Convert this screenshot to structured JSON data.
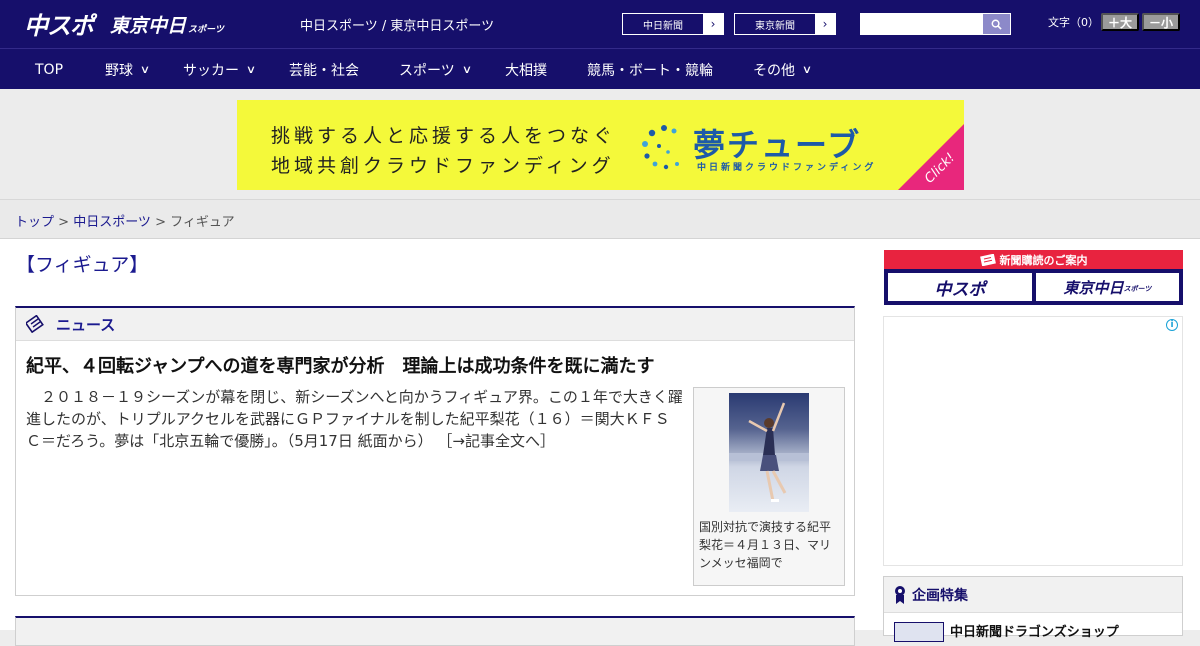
{
  "header": {
    "logo_main": "中スポ",
    "logo_sub": "東京中日",
    "logo_sub_small": "スポーツ",
    "site_title": "中日スポーツ / 東京中日スポーツ",
    "buttons": [
      {
        "label": "中日新聞"
      },
      {
        "label": "東京新聞"
      }
    ],
    "search": {
      "value": "",
      "placeholder": ""
    },
    "font_label": "文字（0）",
    "font_increase": "＋大",
    "font_decrease": "－小"
  },
  "nav": [
    {
      "label": "TOP",
      "dropdown": false
    },
    {
      "label": "野球",
      "dropdown": true
    },
    {
      "label": "サッカー",
      "dropdown": true
    },
    {
      "label": "芸能・社会",
      "dropdown": false
    },
    {
      "label": "スポーツ",
      "dropdown": true
    },
    {
      "label": "大相撲",
      "dropdown": false
    },
    {
      "label": "競馬・ボート・競輪",
      "dropdown": false
    },
    {
      "label": "その他",
      "dropdown": true
    }
  ],
  "banner": {
    "line1": "挑戦する人と応援する人をつなぐ",
    "line2": "地域共創クラウドファンディング",
    "brand": "夢チューブ",
    "brand_sub": "中日新聞クラウドファンディング",
    "click": "Click!"
  },
  "breadcrumb": {
    "home": "トップ",
    "sep1": " > ",
    "section": "中日スポーツ",
    "sep2": " > ",
    "current": "フィギュア"
  },
  "main": {
    "section_heading": "【フィギュア】",
    "news_label": "ニュース",
    "article": {
      "title": "紀平、４回転ジャンプへの道を専門家が分析　理論上は成功条件を既に満たす",
      "body": "　２０１８－１９シーズンが幕を閉じ、新シーズンへと向かうフィギュア界。この１年で大きく躍進したのが、トリプルアクセルを武器にＧＰファイナルを制した紀平梨花（１６）＝関大ＫＦＳＣ＝だろう。夢は「北京五輪で優勝」。（5月17日 紙面から）",
      "more": "［→記事全文へ］",
      "photo_caption": "国別対抗で演技する紀平梨花＝４月１３日、マリンメッセ福岡で"
    }
  },
  "sidebar": {
    "subscribe_head": "新聞購読のご案内",
    "subscribe_logo_1": "中スポ",
    "subscribe_logo_2": "東京中日",
    "subscribe_logo_2_small": "スポーツ",
    "ad_info": "i",
    "feature_head": "企画特集",
    "feature_item": "中日新聞ドラゴンズショップ"
  },
  "colors": {
    "navy": "#160f6b",
    "link": "#1b1a8f",
    "banner_yellow": "#f4f93a",
    "banner_blue": "#1d5aa8",
    "click_pink": "#e8277c",
    "subscribe_red": "#e8233f"
  }
}
